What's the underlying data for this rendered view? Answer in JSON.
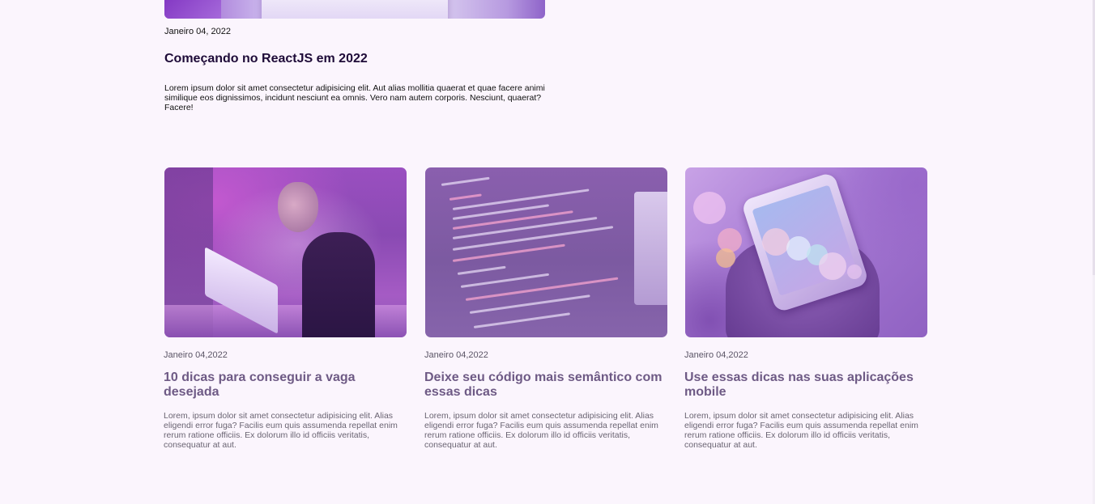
{
  "featured": {
    "date": "Janeiro 04, 2022",
    "title": "Começando no ReactJS em 2022",
    "excerpt": "Lorem ipsum dolor sit amet consectetur adipisicing elit. Aut alias mollitia quaerat et quae facere animi similique eos dignissimos, incidunt nesciunt ea omnis. Vero nam autem corporis. Nesciunt, quaerat? Facere!"
  },
  "cards": [
    {
      "image": "person-using-laptop-photo",
      "date": "Janeiro 04,2022",
      "title": "10 dicas para conseguir a vaga desejada",
      "excerpt": "Lorem, ipsum dolor sit amet consectetur adipisicing elit. Alias eligendi error fuga? Facilis eum quis assumenda repellat enim rerum ratione officiis. Ex dolorum illo id officiis veritatis, consequatur at aut."
    },
    {
      "image": "code-on-screen-photo",
      "date": "Janeiro 04,2022",
      "title": "Deixe seu código mais semântico com essas dicas",
      "excerpt": "Lorem, ipsum dolor sit amet consectetur adipisicing elit. Alias eligendi error fuga? Facilis eum quis assumenda repellat enim rerum ratione officiis. Ex dolorum illo id officiis veritatis, consequatur at aut."
    },
    {
      "image": "phone-in-hand-photo",
      "date": "Janeiro 04,2022",
      "title": "Use essas dicas nas suas aplicações mobile",
      "excerpt": "Lorem, ipsum dolor sit amet consectetur adipisicing elit. Alias eligendi error fuga? Facilis eum quis assumenda repellat enim rerum ratione officiis. Ex dolorum illo id officiis veritatis, consequatur at aut."
    }
  ],
  "colors": {
    "background": "#fbf5fd",
    "featured_title": "#1e0b38",
    "card_title": "#6e5a85",
    "card_text": "#6a6472"
  }
}
